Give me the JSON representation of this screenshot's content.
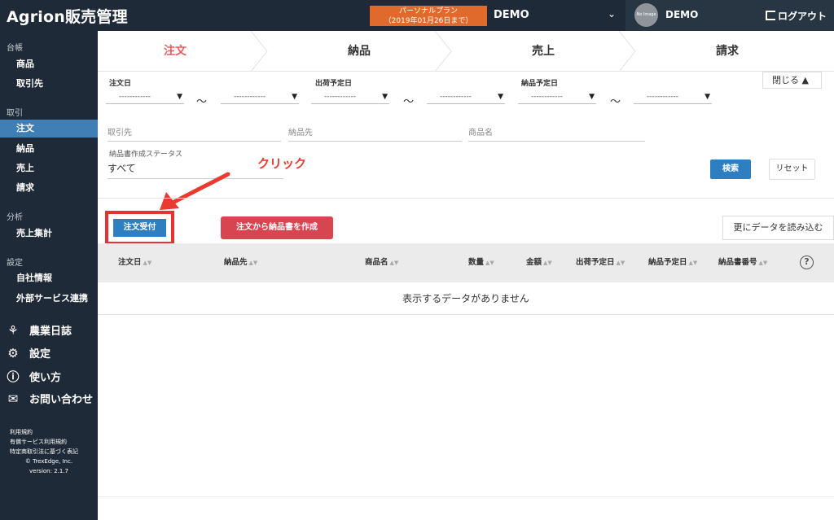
{
  "app": {
    "title": "Agrion販売管理"
  },
  "header": {
    "plan_line1": "パーソナルプラン",
    "plan_line2": "（2019年01月26日まで）",
    "account_name": "DEMO",
    "avatar_text": "No Image",
    "user_name": "DEMO",
    "logout_label": "ログアウト"
  },
  "sidebar": {
    "sections": [
      {
        "title": "台帳",
        "items": [
          "商品",
          "取引先"
        ]
      },
      {
        "title": "取引",
        "items": [
          "注文",
          "納品",
          "売上",
          "請求"
        ]
      },
      {
        "title": "分析",
        "items": [
          "売上集計"
        ]
      },
      {
        "title": "設定",
        "items": [
          "自社情報",
          "外部サービス連携"
        ]
      }
    ],
    "active_item": "注文",
    "extras": [
      "農業日誌",
      "設定",
      "使い方",
      "お問い合わせ"
    ],
    "footer": [
      "利用規約",
      "有償サービス利用規約",
      "特定商取引法に基づく表記",
      "© TrexEdge, Inc.",
      "version: 2.1.7"
    ]
  },
  "steps": [
    "注文",
    "納品",
    "売上",
    "請求"
  ],
  "active_step": "注文",
  "filter": {
    "order_date_label": "注文日",
    "ship_date_label": "出荷予定日",
    "delivery_date_label": "納品予定日",
    "select_placeholder": "------------",
    "tilde": "〜",
    "close_label": "閉じる ▲",
    "customer_label": "取引先",
    "delivery_to_label": "納品先",
    "product_label": "商品名",
    "status_label": "納品書作成ステータス",
    "status_value": "すべて",
    "search_label": "検索",
    "reset_label": "リセット"
  },
  "annotation": "クリック",
  "actions": {
    "accept_label": "注文受付",
    "create_delivery_label": "注文から納品書を作成",
    "load_more_label": "更にデータを読み込む"
  },
  "table": {
    "headers": [
      "注文日",
      "納品先",
      "商品名",
      "数量",
      "金額",
      "出荷予定日",
      "納品予定日",
      "納品書番号"
    ],
    "empty_message": "表示するデータがありません"
  },
  "colors": {
    "nav_bg": "#1f2a38",
    "active": "#3f7fb5",
    "primary_button": "#2d7fc1",
    "danger_button": "#d94451",
    "plan_badge": "#e06a2b",
    "highlight_box": "#e53333"
  }
}
